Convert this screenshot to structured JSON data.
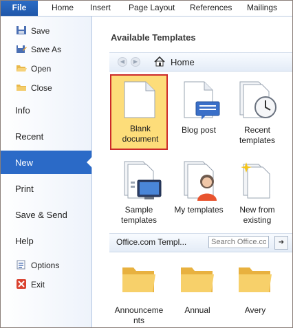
{
  "ribbon": {
    "tabs": [
      "File",
      "Home",
      "Insert",
      "Page Layout",
      "References",
      "Mailings"
    ]
  },
  "nav": {
    "save": "Save",
    "save_as": "Save As",
    "open": "Open",
    "close": "Close",
    "info": "Info",
    "recent": "Recent",
    "new": "New",
    "print": "Print",
    "save_send": "Save & Send",
    "help": "Help",
    "options": "Options",
    "exit": "Exit"
  },
  "main": {
    "title": "Available Templates",
    "breadcrumb": "Home",
    "tiles": {
      "blank": [
        "Blank",
        "document"
      ],
      "blog": [
        "Blog post"
      ],
      "recent": [
        "Recent",
        "templates"
      ],
      "sample": [
        "Sample",
        "templates"
      ],
      "my": [
        "My templates"
      ],
      "existing": [
        "New from",
        "existing"
      ]
    },
    "office_label": "Office.com Templ...",
    "search_placeholder": "Search Office.co",
    "folders": {
      "announcements": [
        "Announceme",
        "nts"
      ],
      "annual": [
        "Annual"
      ],
      "avery": [
        "Avery"
      ]
    }
  },
  "colors": {
    "file_tab": "#2b6cc6",
    "nav_active": "#2b6ac7",
    "selected_tile": "#fddd7a",
    "selected_border": "#cc2a2a"
  }
}
